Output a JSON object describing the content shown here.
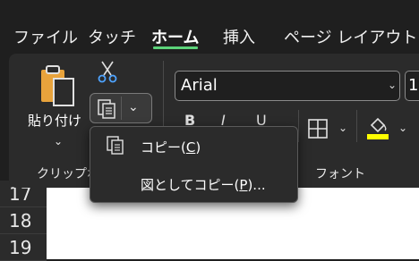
{
  "tabs": [
    {
      "label": "ファイル"
    },
    {
      "label": "タッチ"
    },
    {
      "label": "ホーム",
      "active": true
    },
    {
      "label": "挿入"
    },
    {
      "label": "ページ レイアウト"
    }
  ],
  "clipboard": {
    "paste_label": "貼り付け",
    "group_label": "クリップボ"
  },
  "font": {
    "name": "Arial",
    "size": "1",
    "bold": "B",
    "italic": "I",
    "underline": "U",
    "group_label": "フォント",
    "highlight_color": "#ffff00"
  },
  "copy_menu": {
    "item1": {
      "text": "コピー(",
      "key": "C",
      "suffix": ")"
    },
    "item2": {
      "text": "図としてコピー(",
      "key": "P",
      "suffix": ")..."
    }
  },
  "rows": [
    "17",
    "18",
    "19"
  ],
  "colors": {
    "background": "#1f1f1f",
    "ribbon": "#2b2b2b",
    "active_tab_accent": "#5cd37a",
    "sheet": "#ffffff"
  }
}
